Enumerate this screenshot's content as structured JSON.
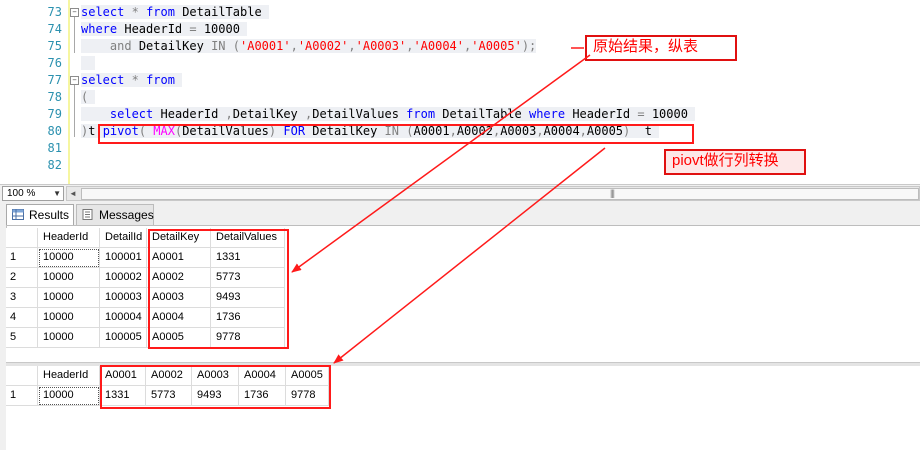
{
  "editor": {
    "line_numbers": [
      "73",
      "74",
      "75",
      "76",
      "77",
      "78",
      "79",
      "80",
      "81",
      "82"
    ],
    "zoom": "100 %"
  },
  "results": {
    "tabs": {
      "results": "Results",
      "messages": "Messages"
    },
    "grid1": {
      "columns": [
        "HeaderId",
        "DetailId",
        "DetailKey",
        "DetailValues"
      ],
      "rows": [
        [
          "1",
          "10000",
          "100001",
          "A0001",
          "1331"
        ],
        [
          "2",
          "10000",
          "100002",
          "A0002",
          "5773"
        ],
        [
          "3",
          "10000",
          "100003",
          "A0003",
          "9493"
        ],
        [
          "4",
          "10000",
          "100004",
          "A0004",
          "1736"
        ],
        [
          "5",
          "10000",
          "100005",
          "A0005",
          "9778"
        ]
      ]
    },
    "grid2": {
      "columns": [
        "HeaderId",
        "A0001",
        "A0002",
        "A0003",
        "A0004",
        "A0005"
      ],
      "rows": [
        [
          "1",
          "10000",
          "1331",
          "5773",
          "9493",
          "1736",
          "9778"
        ]
      ]
    }
  },
  "annotations": {
    "note_original": "原始结果，纵表",
    "note_pivot": "piovt做行列转换"
  },
  "colors": {
    "annotation_red": "#ff1a1a",
    "keyword_blue": "#0000ff",
    "string_red": "#ff0000",
    "function_magenta": "#ff00ff",
    "line_number_teal": "#2b91af"
  }
}
